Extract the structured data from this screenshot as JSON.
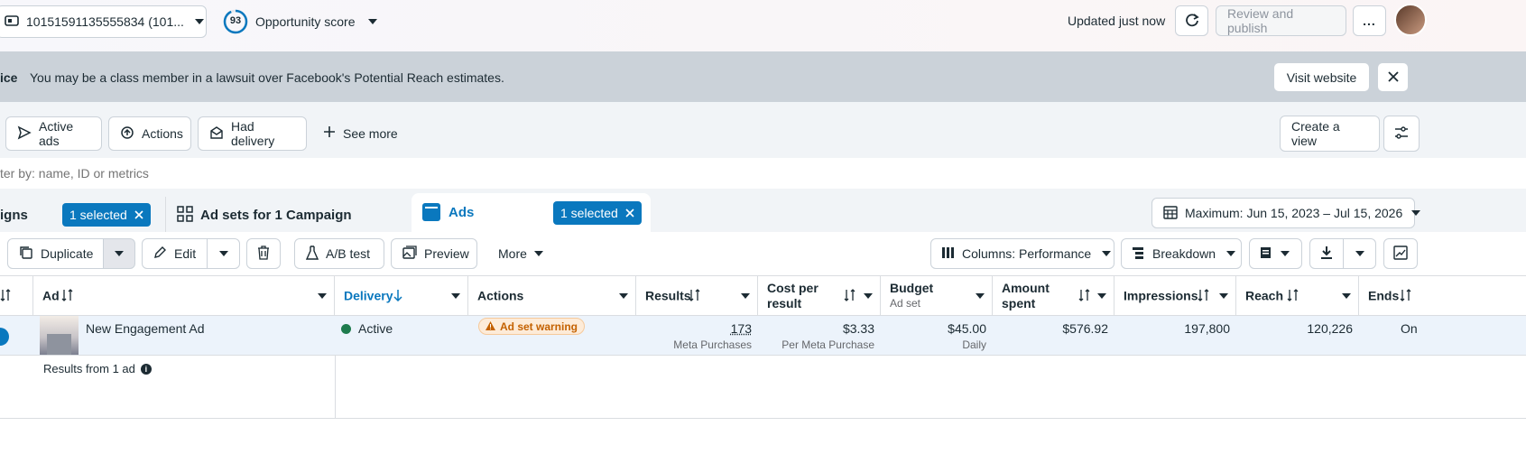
{
  "header": {
    "account_name": "10151591135555834 (101...",
    "opportunity_score": "93",
    "opportunity_label": "Opportunity score",
    "updated": "Updated just now",
    "review_publish": "Review and publish",
    "more": "..."
  },
  "notice": {
    "prefix": "ice",
    "text": "You may be a class member in a lawsuit over Facebook's Potential Reach estimates.",
    "visit": "Visit website"
  },
  "filters": {
    "active_ads": "Active ads",
    "actions": "Actions",
    "had_delivery": "Had delivery",
    "see_more": "See more",
    "create_view": "Create a view"
  },
  "search": {
    "placeholder": "ter by: name, ID or metrics"
  },
  "tabs": {
    "campaigns": "igns",
    "campaigns_selected": "1 selected",
    "adsets": "Ad sets for 1 Campaign",
    "ads": "Ads",
    "ads_selected": "1 selected",
    "date_range": "Maximum: Jun 15, 2023 – Jul 15, 2026"
  },
  "toolbar": {
    "duplicate": "Duplicate",
    "edit": "Edit",
    "ab_test": "A/B test",
    "preview": "Preview",
    "more": "More",
    "columns": "Columns: Performance",
    "breakdown": "Breakdown"
  },
  "table": {
    "headers": {
      "ad": "Ad",
      "delivery": "Delivery",
      "actions": "Actions",
      "results": "Results",
      "cost_per_result": "Cost per result",
      "budget": "Budget",
      "budget_sub": "Ad set",
      "amount_spent": "Amount spent",
      "impressions": "Impressions",
      "reach": "Reach",
      "ends": "Ends"
    },
    "row": {
      "ad_name": "New Engagement Ad",
      "delivery": "Active",
      "warning": "Ad set warning",
      "results": "173",
      "results_sub": "Meta Purchases",
      "cost": "$3.33",
      "cost_sub": "Per Meta Purchase",
      "budget": "$45.00",
      "budget_sub": "Daily",
      "amount_spent": "$576.92",
      "impressions": "197,800",
      "reach": "120,226",
      "ends": "On"
    },
    "footer": "Results from 1 ad"
  },
  "colors": {
    "accent": "#0a78be",
    "active": "#1e7b4d",
    "warning": "#c46100"
  }
}
